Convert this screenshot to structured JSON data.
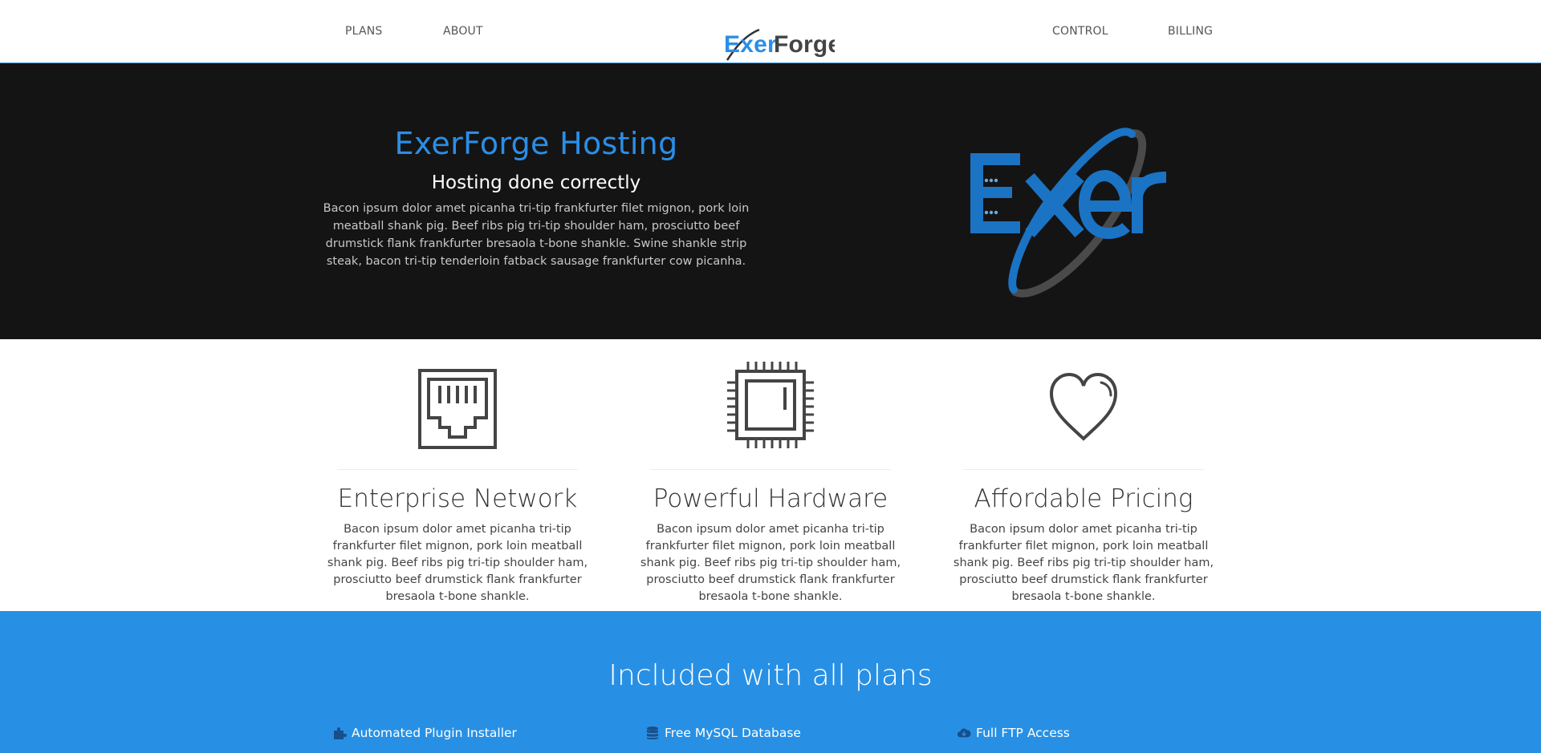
{
  "nav": {
    "links_left": [
      "PLANS",
      "ABOUT"
    ],
    "links_right": [
      "CONTROL",
      "BILLING"
    ],
    "logo": {
      "part1": "Exer",
      "part2": "Forge"
    }
  },
  "hero": {
    "title": "ExerForge Hosting",
    "subtitle": "Hosting done correctly",
    "description": "Bacon ipsum dolor amet picanha tri-tip frankfurter filet mignon, pork loin meatball shank pig. Beef ribs pig tri-tip shoulder ham, prosciutto beef drumstick flank frankfurter bresaola t-bone shankle. Swine shankle strip steak, bacon tri-tip tenderloin fatback sausage frankfurter cow picanha.",
    "logo_text": "Exer"
  },
  "features": [
    {
      "icon": "ethernet-port-icon",
      "title": "Enterprise Network",
      "description": "Bacon ipsum dolor amet picanha tri-tip frankfurter filet mignon, pork loin meatball shank pig. Beef ribs pig tri-tip shoulder ham, prosciutto beef drumstick flank frankfurter bresaola t-bone shankle."
    },
    {
      "icon": "cpu-chip-icon",
      "title": "Powerful Hardware",
      "description": "Bacon ipsum dolor amet picanha tri-tip frankfurter filet mignon, pork loin meatball shank pig. Beef ribs pig tri-tip shoulder ham, prosciutto beef drumstick flank frankfurter bresaola t-bone shankle."
    },
    {
      "icon": "heart-icon",
      "title": "Affordable Pricing",
      "description": "Bacon ipsum dolor amet picanha tri-tip frankfurter filet mignon, pork loin meatball shank pig. Beef ribs pig tri-tip shoulder ham, prosciutto beef drumstick flank frankfurter bresaola t-bone shankle."
    }
  ],
  "included": {
    "title": "Included with all plans",
    "items": [
      {
        "icon": "puzzle-icon",
        "label": "Automated Plugin Installer"
      },
      {
        "icon": "database-icon",
        "label": "Free MySQL Database"
      },
      {
        "icon": "cloud-download-icon",
        "label": "Full FTP Access"
      }
    ]
  },
  "colors": {
    "brand_blue": "#2b8ee6",
    "hero_bg": "#141414",
    "included_bg": "#2890e4",
    "icon_gray": "#444444"
  }
}
